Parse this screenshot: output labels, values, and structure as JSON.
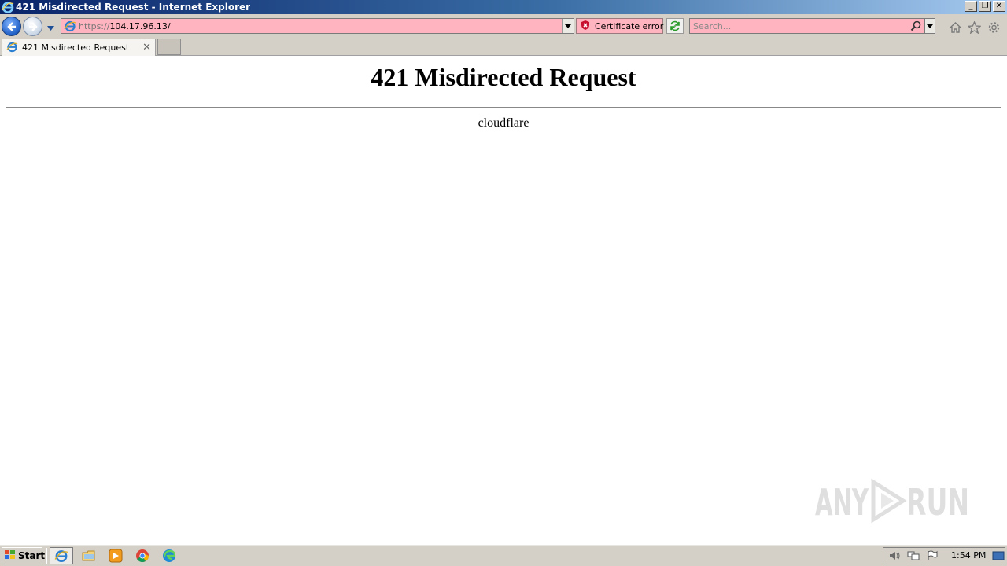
{
  "window": {
    "title": "421 Misdirected Request - Internet Explorer",
    "controls": [
      "minimize",
      "restore",
      "close"
    ]
  },
  "navbar": {
    "url_protocol": "https://",
    "url_host": "104.17.96.13/",
    "certificate_label": "Certificate error",
    "search_placeholder": "Search...",
    "icons": [
      "back-icon",
      "forward-icon",
      "recent-pages-icon",
      "ie-page-icon",
      "certificate-error-icon",
      "refresh-icon",
      "search-icon",
      "home-icon",
      "favorites-icon",
      "tools-icon"
    ]
  },
  "tabs": [
    {
      "label": "421 Misdirected Request",
      "active": true
    }
  ],
  "page": {
    "heading": "421 Misdirected Request",
    "server": "cloudflare"
  },
  "watermark": {
    "text": "ANY RUN"
  },
  "taskbar": {
    "start_label": "Start",
    "apps": [
      "internet-explorer",
      "file-explorer",
      "windows-media-player",
      "chrome",
      "edge"
    ],
    "clock": "1:54 PM"
  },
  "colors": {
    "titlebar_start": "#0a246a",
    "titlebar_end": "#a6caf0",
    "error_field": "#ffb4c0",
    "chrome": "#d4d0c8"
  }
}
